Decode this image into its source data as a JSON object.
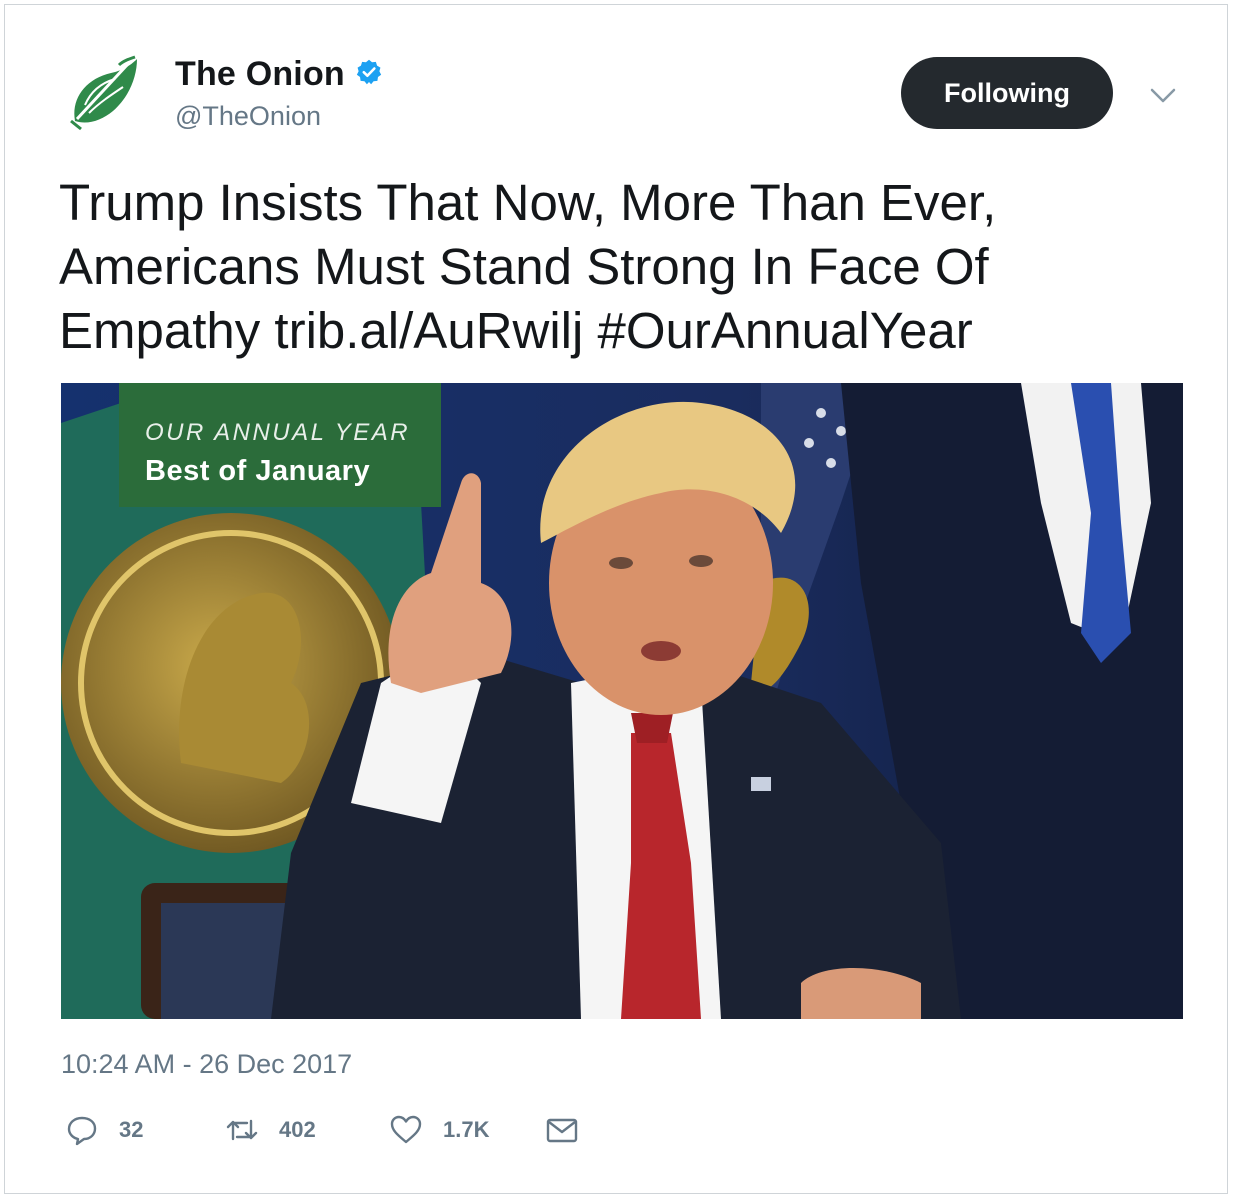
{
  "tweet": {
    "author": {
      "display_name": "The Onion",
      "handle": "@TheOnion",
      "verified": true,
      "avatar_icon": "onion-logo-icon",
      "brand_color": "#2f8a4a"
    },
    "follow_button_label": "Following",
    "menu_icon": "chevron-down-icon",
    "text": "Trump Insists That Now, More Than Ever, Americans Must Stand Strong In Face Of Empathy trib.al/AuRwilj #OurAnnualYear",
    "media": {
      "banner_line1": "OUR ANNUAL YEAR",
      "banner_line2": "Best of January",
      "banner_color": "#2b6c3a"
    },
    "timestamp": "10:24 AM - 26 Dec 2017",
    "actions": {
      "reply": {
        "icon": "reply-icon",
        "count": "32"
      },
      "retweet": {
        "icon": "retweet-icon",
        "count": "402"
      },
      "like": {
        "icon": "heart-icon",
        "count": "1.7K"
      },
      "message": {
        "icon": "envelope-icon"
      }
    }
  }
}
